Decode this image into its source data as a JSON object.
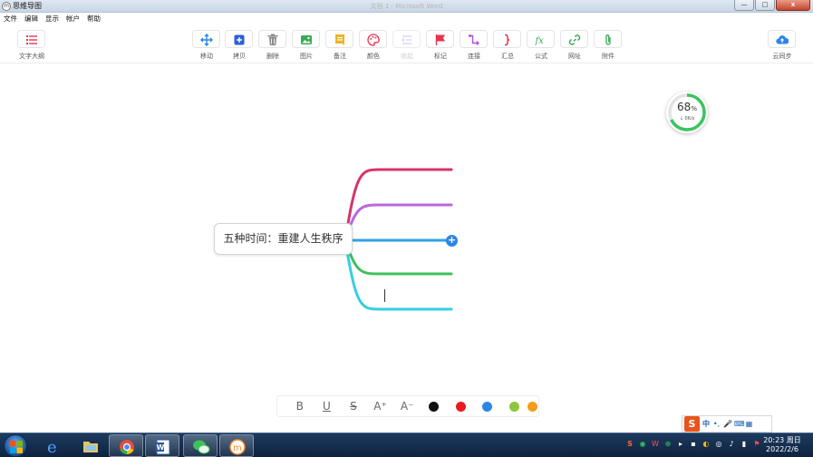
{
  "window": {
    "app_icon": "m",
    "app_title": "思维导图",
    "document_title": "文档 1 - Microsoft Word",
    "minimize": "—",
    "maximize": "□",
    "close": "x"
  },
  "menu": [
    "文件",
    "编辑",
    "显示",
    "帐户",
    "帮助"
  ],
  "toolbar": {
    "outline": {
      "label": "文字大纲",
      "icon": "list-icon",
      "color": "#e8344f"
    },
    "cloud": {
      "label": "云同步",
      "icon": "cloud-upload-icon",
      "color": "#2d86e6"
    },
    "tools": [
      {
        "id": "move",
        "label": "移动",
        "icon": "move-icon",
        "color": "#2d86e6",
        "enabled": true
      },
      {
        "id": "copy",
        "label": "拷贝",
        "icon": "copy-icon",
        "color": "#2d5fd4",
        "enabled": true
      },
      {
        "id": "delete",
        "label": "删除",
        "icon": "trash-icon",
        "color": "#8a8a8a",
        "enabled": true
      },
      {
        "id": "image",
        "label": "图片",
        "icon": "image-icon",
        "color": "#3aaa55",
        "enabled": true
      },
      {
        "id": "note",
        "label": "备注",
        "icon": "note-icon",
        "color": "#f0b323",
        "enabled": true
      },
      {
        "id": "color",
        "label": "颜色",
        "icon": "palette-icon",
        "color": "#e8344f",
        "enabled": true
      },
      {
        "id": "collapse",
        "label": "收起",
        "icon": "collapse-icon",
        "color": "#cdb8e6",
        "enabled": false
      },
      {
        "id": "mark",
        "label": "标记",
        "icon": "flag-icon",
        "color": "#e8344f",
        "enabled": true
      },
      {
        "id": "connect",
        "label": "连接",
        "icon": "connect-icon",
        "color": "#b44ee0",
        "enabled": true
      },
      {
        "id": "summary",
        "label": "汇总",
        "icon": "bracket-icon",
        "color": "#e8344f",
        "enabled": true
      },
      {
        "id": "formula",
        "label": "公式",
        "icon": "formula-icon",
        "color": "#3aaa55",
        "enabled": true
      },
      {
        "id": "url",
        "label": "网址",
        "icon": "link-icon",
        "color": "#3aaa55",
        "enabled": true
      },
      {
        "id": "attach",
        "label": "附件",
        "icon": "paperclip-icon",
        "color": "#3aaa55",
        "enabled": true
      }
    ]
  },
  "speed_widget": {
    "percent": "68",
    "unit": "%",
    "rate": "↓ 0K/s",
    "fraction": 0.68,
    "color": "#3bc45e"
  },
  "mindmap": {
    "central": "五种时间：重建人生秩序",
    "expand": "+",
    "branch_colors": [
      "#d8336d",
      "#b967e0",
      "#2ea2e6",
      "#3ec15c",
      "#35cfe0"
    ]
  },
  "format_bar": {
    "buttons": [
      {
        "id": "bold",
        "label": "B"
      },
      {
        "id": "underline",
        "label": "U"
      },
      {
        "id": "strike",
        "label": "S"
      },
      {
        "id": "font-increase",
        "label": "A⁺"
      },
      {
        "id": "font-decrease",
        "label": "A⁻"
      }
    ],
    "colors": [
      "#111111",
      "#e81c1c",
      "#2d86e6",
      "#8dc63f",
      "#f59c1a"
    ]
  },
  "ime": {
    "logo": "S",
    "mode": "中",
    "punct": "•,",
    "mic": "🎤",
    "keyboard": "⌨",
    "menu": "▦"
  },
  "taskbar": {
    "apps": [
      {
        "id": "ie",
        "icon": "ie-icon",
        "active": false
      },
      {
        "id": "explorer",
        "icon": "folder-icon",
        "active": false
      },
      {
        "id": "chrome",
        "icon": "chrome-icon",
        "active": false
      },
      {
        "id": "word",
        "icon": "word-icon",
        "active": false
      },
      {
        "id": "wechat",
        "icon": "wechat-icon",
        "active": false
      },
      {
        "id": "mindmap",
        "icon": "mindmap-app-icon",
        "active": true
      }
    ],
    "tray": [
      "S",
      "◉",
      "W",
      "⊕",
      "▸",
      "▪",
      "◐",
      "◎",
      "♪",
      "▮",
      "⚑"
    ],
    "time": "20:23 周日",
    "date": "2022/2/6"
  }
}
